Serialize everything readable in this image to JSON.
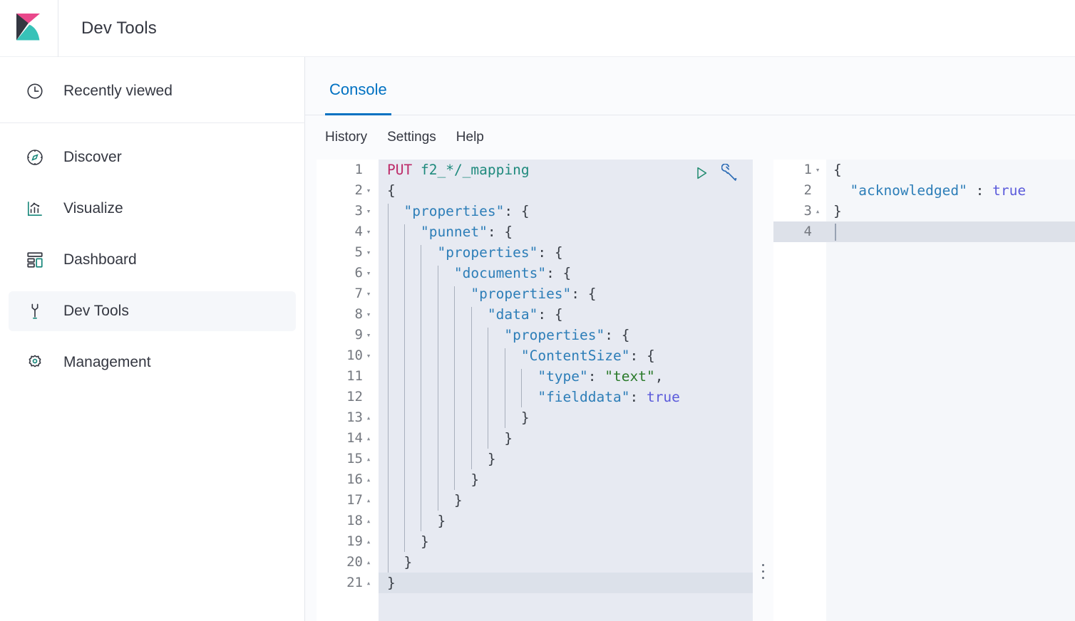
{
  "header": {
    "logo_icon": "kibana-logo",
    "title": "Dev Tools"
  },
  "sidebar": {
    "recent": {
      "label": "Recently viewed",
      "icon": "clock-icon"
    },
    "items": [
      {
        "label": "Discover",
        "icon": "compass-icon",
        "selected": false
      },
      {
        "label": "Visualize",
        "icon": "bar-chart-icon",
        "selected": false
      },
      {
        "label": "Dashboard",
        "icon": "dashboard-icon",
        "selected": false
      },
      {
        "label": "Dev Tools",
        "icon": "wrench-icon",
        "selected": true
      },
      {
        "label": "Management",
        "icon": "gear-icon",
        "selected": false
      }
    ]
  },
  "main": {
    "tabs": [
      {
        "label": "Console",
        "active": true
      }
    ],
    "toolbar": [
      {
        "label": "History"
      },
      {
        "label": "Settings"
      },
      {
        "label": "Help"
      }
    ],
    "editor_actions": [
      {
        "icon": "play-icon",
        "title": "Click to send request"
      },
      {
        "icon": "wrench-icon",
        "title": "Open documentation"
      }
    ]
  },
  "request_editor": {
    "active_line": 21,
    "lines": [
      {
        "n": 1,
        "fold": "",
        "tokens": [
          {
            "t": "method",
            "v": "PUT"
          },
          {
            "t": "plain",
            "v": " "
          },
          {
            "t": "url",
            "v": "f2_*/_mapping"
          }
        ]
      },
      {
        "n": 2,
        "fold": "▾",
        "tokens": [
          {
            "t": "punc",
            "v": "{"
          }
        ]
      },
      {
        "n": 3,
        "fold": "▾",
        "tokens": [
          {
            "t": "plain",
            "v": "  "
          },
          {
            "t": "key",
            "v": "\"properties\""
          },
          {
            "t": "punc",
            "v": ": {"
          }
        ]
      },
      {
        "n": 4,
        "fold": "▾",
        "tokens": [
          {
            "t": "plain",
            "v": "    "
          },
          {
            "t": "key",
            "v": "\"punnet\""
          },
          {
            "t": "punc",
            "v": ": {"
          }
        ]
      },
      {
        "n": 5,
        "fold": "▾",
        "tokens": [
          {
            "t": "plain",
            "v": "      "
          },
          {
            "t": "key",
            "v": "\"properties\""
          },
          {
            "t": "punc",
            "v": ": {"
          }
        ]
      },
      {
        "n": 6,
        "fold": "▾",
        "tokens": [
          {
            "t": "plain",
            "v": "        "
          },
          {
            "t": "key",
            "v": "\"documents\""
          },
          {
            "t": "punc",
            "v": ": {"
          }
        ]
      },
      {
        "n": 7,
        "fold": "▾",
        "tokens": [
          {
            "t": "plain",
            "v": "          "
          },
          {
            "t": "key",
            "v": "\"properties\""
          },
          {
            "t": "punc",
            "v": ": {"
          }
        ]
      },
      {
        "n": 8,
        "fold": "▾",
        "tokens": [
          {
            "t": "plain",
            "v": "            "
          },
          {
            "t": "key",
            "v": "\"data\""
          },
          {
            "t": "punc",
            "v": ": {"
          }
        ]
      },
      {
        "n": 9,
        "fold": "▾",
        "tokens": [
          {
            "t": "plain",
            "v": "              "
          },
          {
            "t": "key",
            "v": "\"properties\""
          },
          {
            "t": "punc",
            "v": ": {"
          }
        ]
      },
      {
        "n": 10,
        "fold": "▾",
        "tokens": [
          {
            "t": "plain",
            "v": "                "
          },
          {
            "t": "key",
            "v": "\"ContentSize\""
          },
          {
            "t": "punc",
            "v": ": {"
          }
        ]
      },
      {
        "n": 11,
        "fold": "",
        "tokens": [
          {
            "t": "plain",
            "v": "                  "
          },
          {
            "t": "key",
            "v": "\"type\""
          },
          {
            "t": "punc",
            "v": ": "
          },
          {
            "t": "str",
            "v": "\"text\""
          },
          {
            "t": "punc",
            "v": ","
          }
        ]
      },
      {
        "n": 12,
        "fold": "",
        "tokens": [
          {
            "t": "plain",
            "v": "                  "
          },
          {
            "t": "key",
            "v": "\"fielddata\""
          },
          {
            "t": "punc",
            "v": ": "
          },
          {
            "t": "bool",
            "v": "true"
          }
        ]
      },
      {
        "n": 13,
        "fold": "▴",
        "tokens": [
          {
            "t": "plain",
            "v": "                "
          },
          {
            "t": "punc",
            "v": "}"
          }
        ]
      },
      {
        "n": 14,
        "fold": "▴",
        "tokens": [
          {
            "t": "plain",
            "v": "              "
          },
          {
            "t": "punc",
            "v": "}"
          }
        ]
      },
      {
        "n": 15,
        "fold": "▴",
        "tokens": [
          {
            "t": "plain",
            "v": "            "
          },
          {
            "t": "punc",
            "v": "}"
          }
        ]
      },
      {
        "n": 16,
        "fold": "▴",
        "tokens": [
          {
            "t": "plain",
            "v": "          "
          },
          {
            "t": "punc",
            "v": "}"
          }
        ]
      },
      {
        "n": 17,
        "fold": "▴",
        "tokens": [
          {
            "t": "plain",
            "v": "        "
          },
          {
            "t": "punc",
            "v": "}"
          }
        ]
      },
      {
        "n": 18,
        "fold": "▴",
        "tokens": [
          {
            "t": "plain",
            "v": "      "
          },
          {
            "t": "punc",
            "v": "}"
          }
        ]
      },
      {
        "n": 19,
        "fold": "▴",
        "tokens": [
          {
            "t": "plain",
            "v": "    "
          },
          {
            "t": "punc",
            "v": "}"
          }
        ]
      },
      {
        "n": 20,
        "fold": "▴",
        "tokens": [
          {
            "t": "plain",
            "v": "  "
          },
          {
            "t": "punc",
            "v": "}"
          }
        ]
      },
      {
        "n": 21,
        "fold": "▴",
        "tokens": [
          {
            "t": "punc",
            "v": "}"
          }
        ]
      }
    ]
  },
  "response_editor": {
    "active_line": 4,
    "lines": [
      {
        "n": 1,
        "fold": "▾",
        "tokens": [
          {
            "t": "punc",
            "v": "{"
          }
        ]
      },
      {
        "n": 2,
        "fold": "",
        "tokens": [
          {
            "t": "plain",
            "v": "  "
          },
          {
            "t": "key",
            "v": "\"acknowledged\""
          },
          {
            "t": "punc",
            "v": " : "
          },
          {
            "t": "bool",
            "v": "true"
          }
        ]
      },
      {
        "n": 3,
        "fold": "▴",
        "tokens": [
          {
            "t": "punc",
            "v": "}"
          }
        ]
      },
      {
        "n": 4,
        "fold": "",
        "tokens": []
      }
    ]
  },
  "colors": {
    "accent_blue": "#0071c2",
    "method": "#bd2a68",
    "url": "#1f8a7d",
    "key": "#2d7eb8",
    "string": "#2a7a2a",
    "boolean": "#5b5bdb",
    "editor_bg": "#e7eaf2",
    "editor_active_line": "#dce1ea",
    "response_bg": "#f5f7fa",
    "logo_pink": "#e9488b",
    "logo_teal": "#37c2b8",
    "logo_navy": "#343741"
  }
}
